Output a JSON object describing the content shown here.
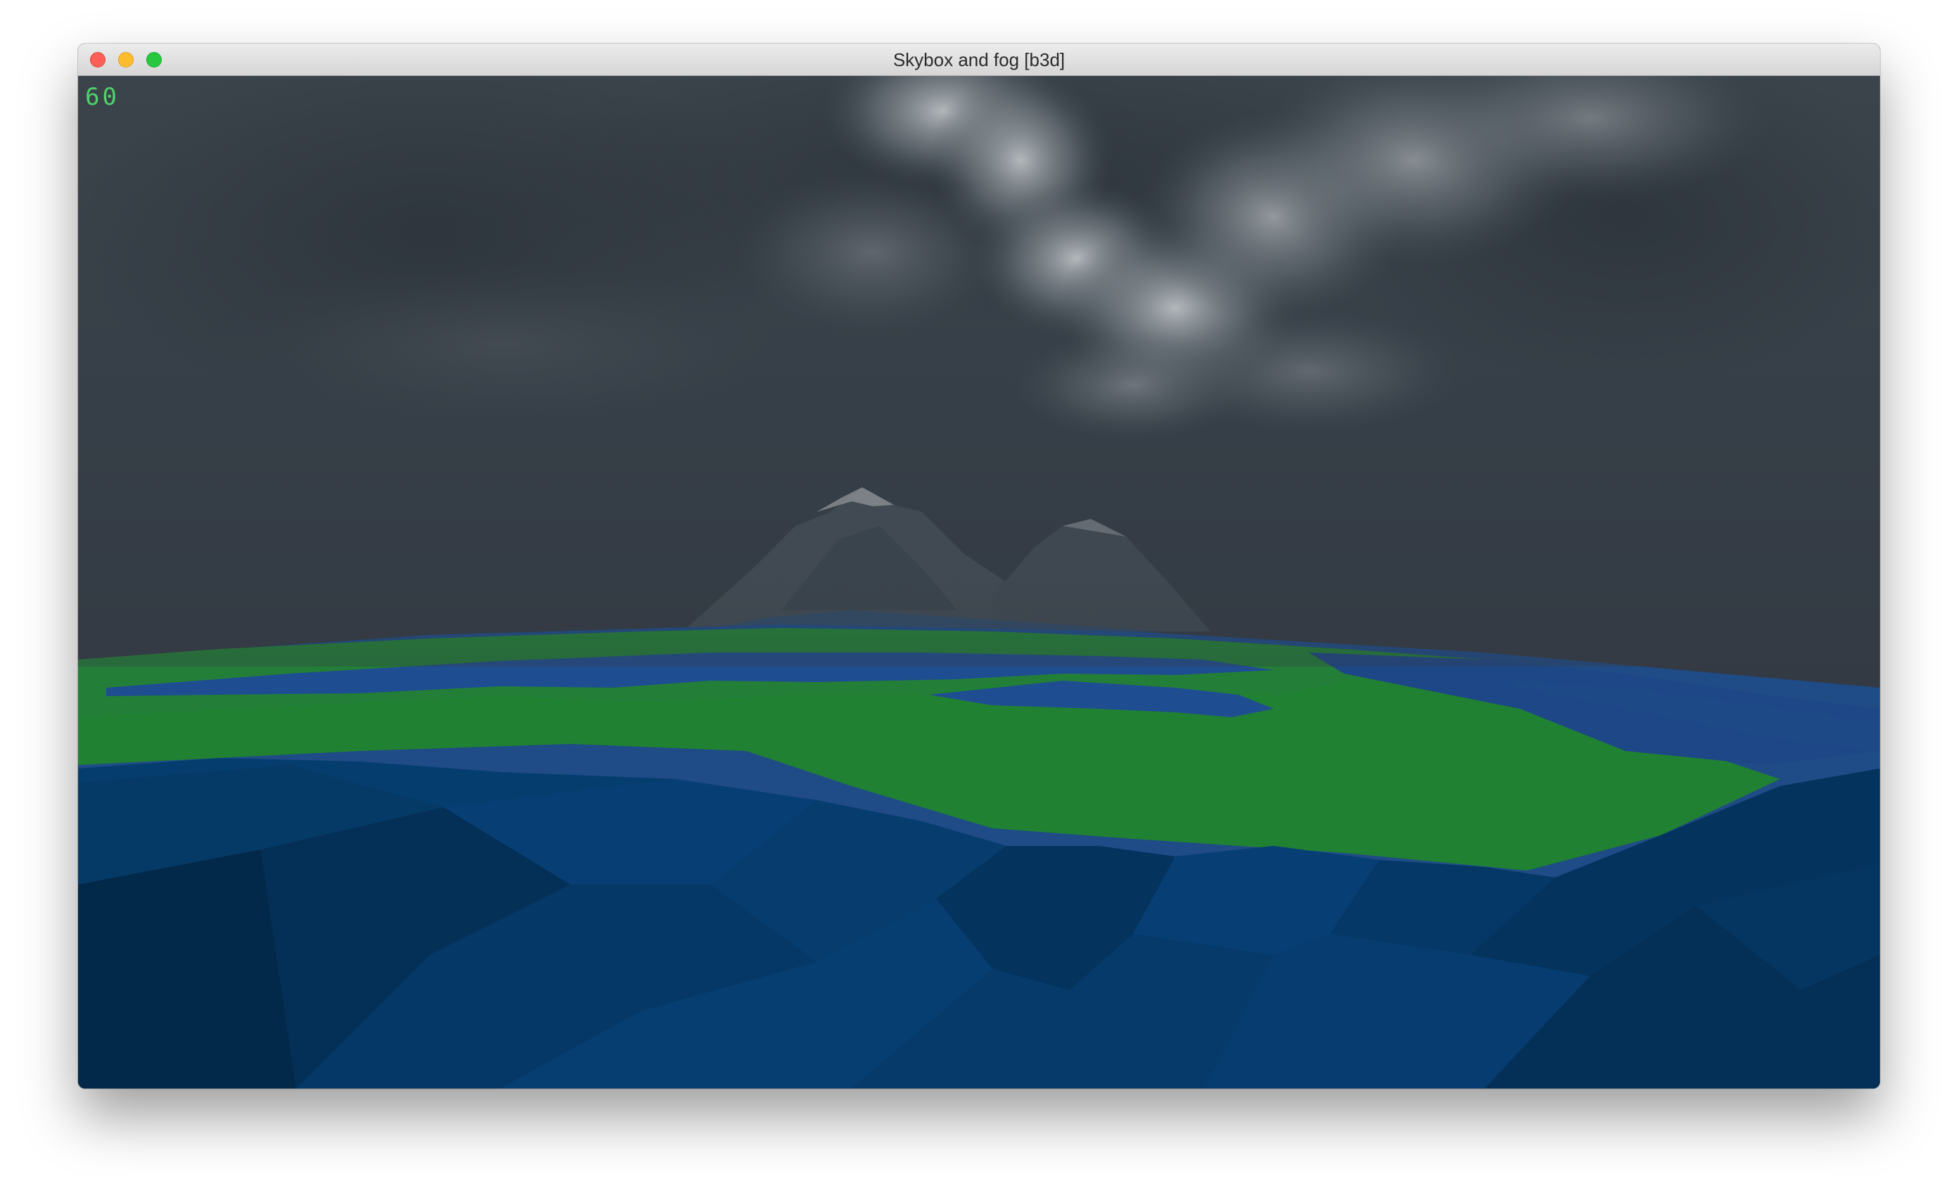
{
  "window": {
    "title": "Skybox and fog [b3d]"
  },
  "overlay": {
    "fps": "60"
  },
  "colors": {
    "sky": "#353d45",
    "cloud": "#8a9196",
    "terrain_green": "#208133",
    "water_blue": "#1f4a8a",
    "fps_text": "#4fd36b",
    "close": "#fc5f57",
    "minimize": "#fdbc2e",
    "zoom": "#27c840"
  }
}
